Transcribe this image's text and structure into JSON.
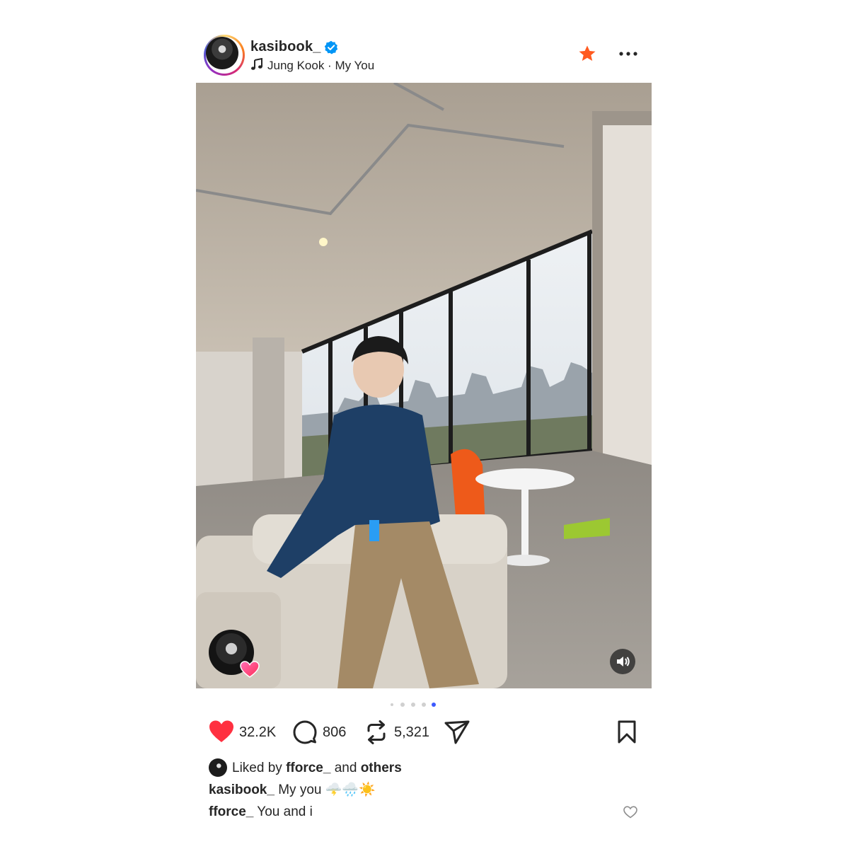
{
  "post": {
    "username": "kasibook_",
    "verified": true,
    "music": "Jung Kook · My You",
    "icons": {
      "music": "music-note-icon",
      "verified": "verified-badge-icon",
      "favorite": "star-icon",
      "more": "more-options-icon"
    },
    "accent_colors": {
      "star": "#ff5a1f",
      "heart": "#ff3040",
      "verified": "#0095f6",
      "carousel_active": "#3d5afe"
    }
  },
  "media": {
    "carousel": {
      "total": 5,
      "active": 5
    },
    "mute_icon": "speaker-icon",
    "reaction_icon": "heart-icon"
  },
  "actions": {
    "likes": "32.2K",
    "comments": "806",
    "reposts": "5,321",
    "icons": [
      "heart-icon",
      "comment-icon",
      "repost-icon",
      "share-icon",
      "bookmark-icon"
    ]
  },
  "liked_by": {
    "prefix": "Liked by",
    "user": "fforce_",
    "joiner": "and",
    "others": "others"
  },
  "caption": {
    "user": "kasibook_",
    "text": "My you 🌩️🌧️☀️"
  },
  "comment": {
    "user": "fforce_",
    "text": "You and i"
  }
}
